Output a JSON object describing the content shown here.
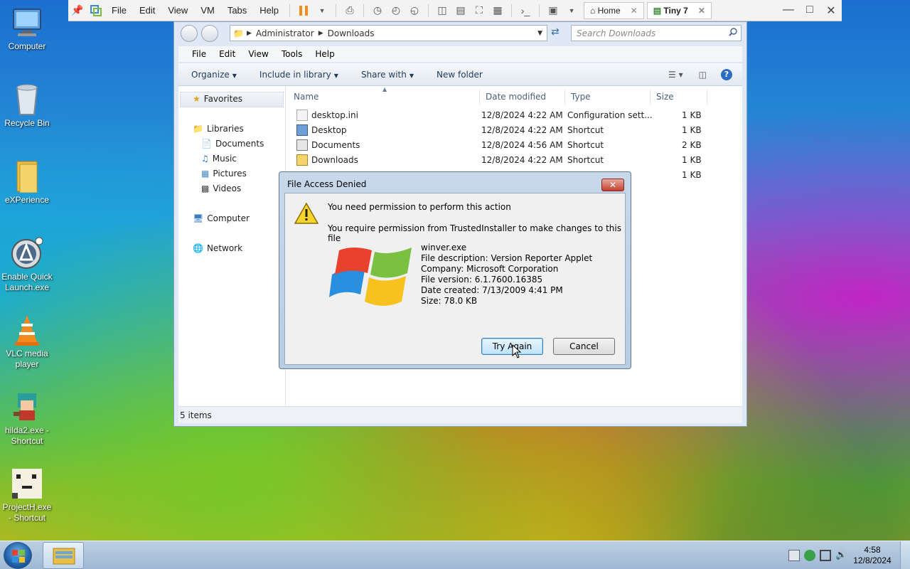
{
  "vm_toolbar": {
    "menus": [
      "File",
      "Edit",
      "View",
      "VM",
      "Tabs",
      "Help"
    ],
    "tabs": [
      {
        "label": "Home",
        "active": false
      },
      {
        "label": "Tiny 7",
        "active": true
      }
    ]
  },
  "desktop_icons": [
    {
      "label": "Computer",
      "icon": "computer-icon"
    },
    {
      "label": "Recycle Bin",
      "icon": "recycle-bin-icon"
    },
    {
      "label": "eXPerience",
      "icon": "folder-icon"
    },
    {
      "label": "Enable Quick Launch.exe",
      "icon": "quick-launch-icon"
    },
    {
      "label": "VLC media player",
      "icon": "vlc-icon"
    },
    {
      "label": "hilda2.exe - Shortcut",
      "icon": "hilda-icon"
    },
    {
      "label": "ProjectH.exe - Shortcut",
      "icon": "projecth-icon"
    }
  ],
  "explorer": {
    "breadcrumb": [
      "Administrator",
      "Downloads"
    ],
    "search_placeholder": "Search Downloads",
    "menus": [
      "File",
      "Edit",
      "View",
      "Tools",
      "Help"
    ],
    "commands": [
      "Organize",
      "Include in library",
      "Share with",
      "New folder"
    ],
    "nav": {
      "favorites": "Favorites",
      "libraries": "Libraries",
      "library_items": [
        "Documents",
        "Music",
        "Pictures",
        "Videos"
      ],
      "computer": "Computer",
      "network": "Network"
    },
    "columns": [
      "Name",
      "Date modified",
      "Type",
      "Size"
    ],
    "files": [
      {
        "name": "desktop.ini",
        "date": "12/8/2024 4:22 AM",
        "type": "Configuration sett...",
        "size": "1 KB"
      },
      {
        "name": "Desktop",
        "date": "12/8/2024 4:22 AM",
        "type": "Shortcut",
        "size": "1 KB"
      },
      {
        "name": "Documents",
        "date": "12/8/2024 4:56 AM",
        "type": "Shortcut",
        "size": "2 KB"
      },
      {
        "name": "Downloads",
        "date": "12/8/2024 4:22 AM",
        "type": "Shortcut",
        "size": "1 KB"
      },
      {
        "name": "",
        "date": "",
        "type": "",
        "size": "1 KB"
      }
    ],
    "status": "5 items"
  },
  "dialog": {
    "title": "File Access Denied",
    "heading": "You need permission to perform this action",
    "message": "You require permission from TrustedInstaller to make changes to this file",
    "file_info": [
      "winver.exe",
      "File description: Version Reporter Applet",
      "Company: Microsoft Corporation",
      "File version: 6.1.7600.16385",
      "Date created: 7/13/2009 4:41 PM",
      "Size: 78.0 KB"
    ],
    "try_again": "Try Again",
    "cancel": "Cancel"
  },
  "taskbar": {
    "time": "4:58",
    "date": "12/8/2024"
  }
}
